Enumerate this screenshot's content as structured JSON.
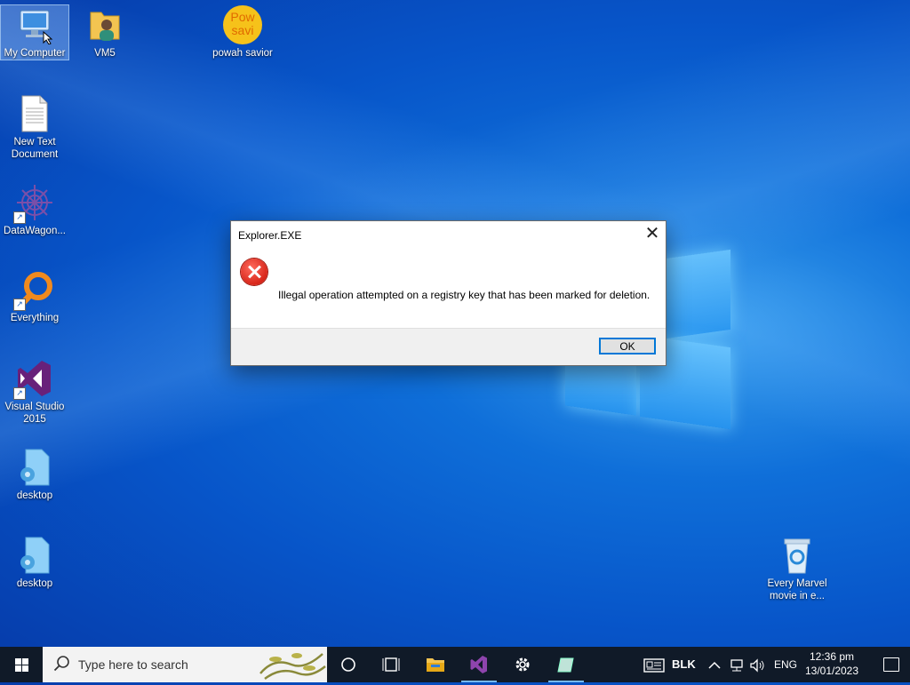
{
  "desktop": {
    "icons": [
      {
        "label": "My Computer"
      },
      {
        "label": "VM5"
      },
      {
        "label": "powah savior",
        "glyph_text": "Pow\nsavi"
      },
      {
        "label": "New Text Document"
      },
      {
        "label": "DataWagon..."
      },
      {
        "label": "Everything"
      },
      {
        "label": "Visual Studio 2015"
      },
      {
        "label": "desktop"
      },
      {
        "label": "desktop"
      },
      {
        "label": "Every Marvel movie in e..."
      }
    ]
  },
  "dialog": {
    "title": "Explorer.EXE",
    "close_glyph": "✕",
    "message": "Illegal operation attempted on a registry key that has been marked for deletion.",
    "ok_label": "OK"
  },
  "taskbar": {
    "search_placeholder": "Type here to search",
    "tray": {
      "keyboard_label": "BLK",
      "language": "ENG",
      "time": "12:36 pm",
      "date": "13/01/2023"
    }
  },
  "colors": {
    "accent": "#0078d7",
    "taskbar_bg": "#101a28",
    "error_red": "#d8261a"
  }
}
